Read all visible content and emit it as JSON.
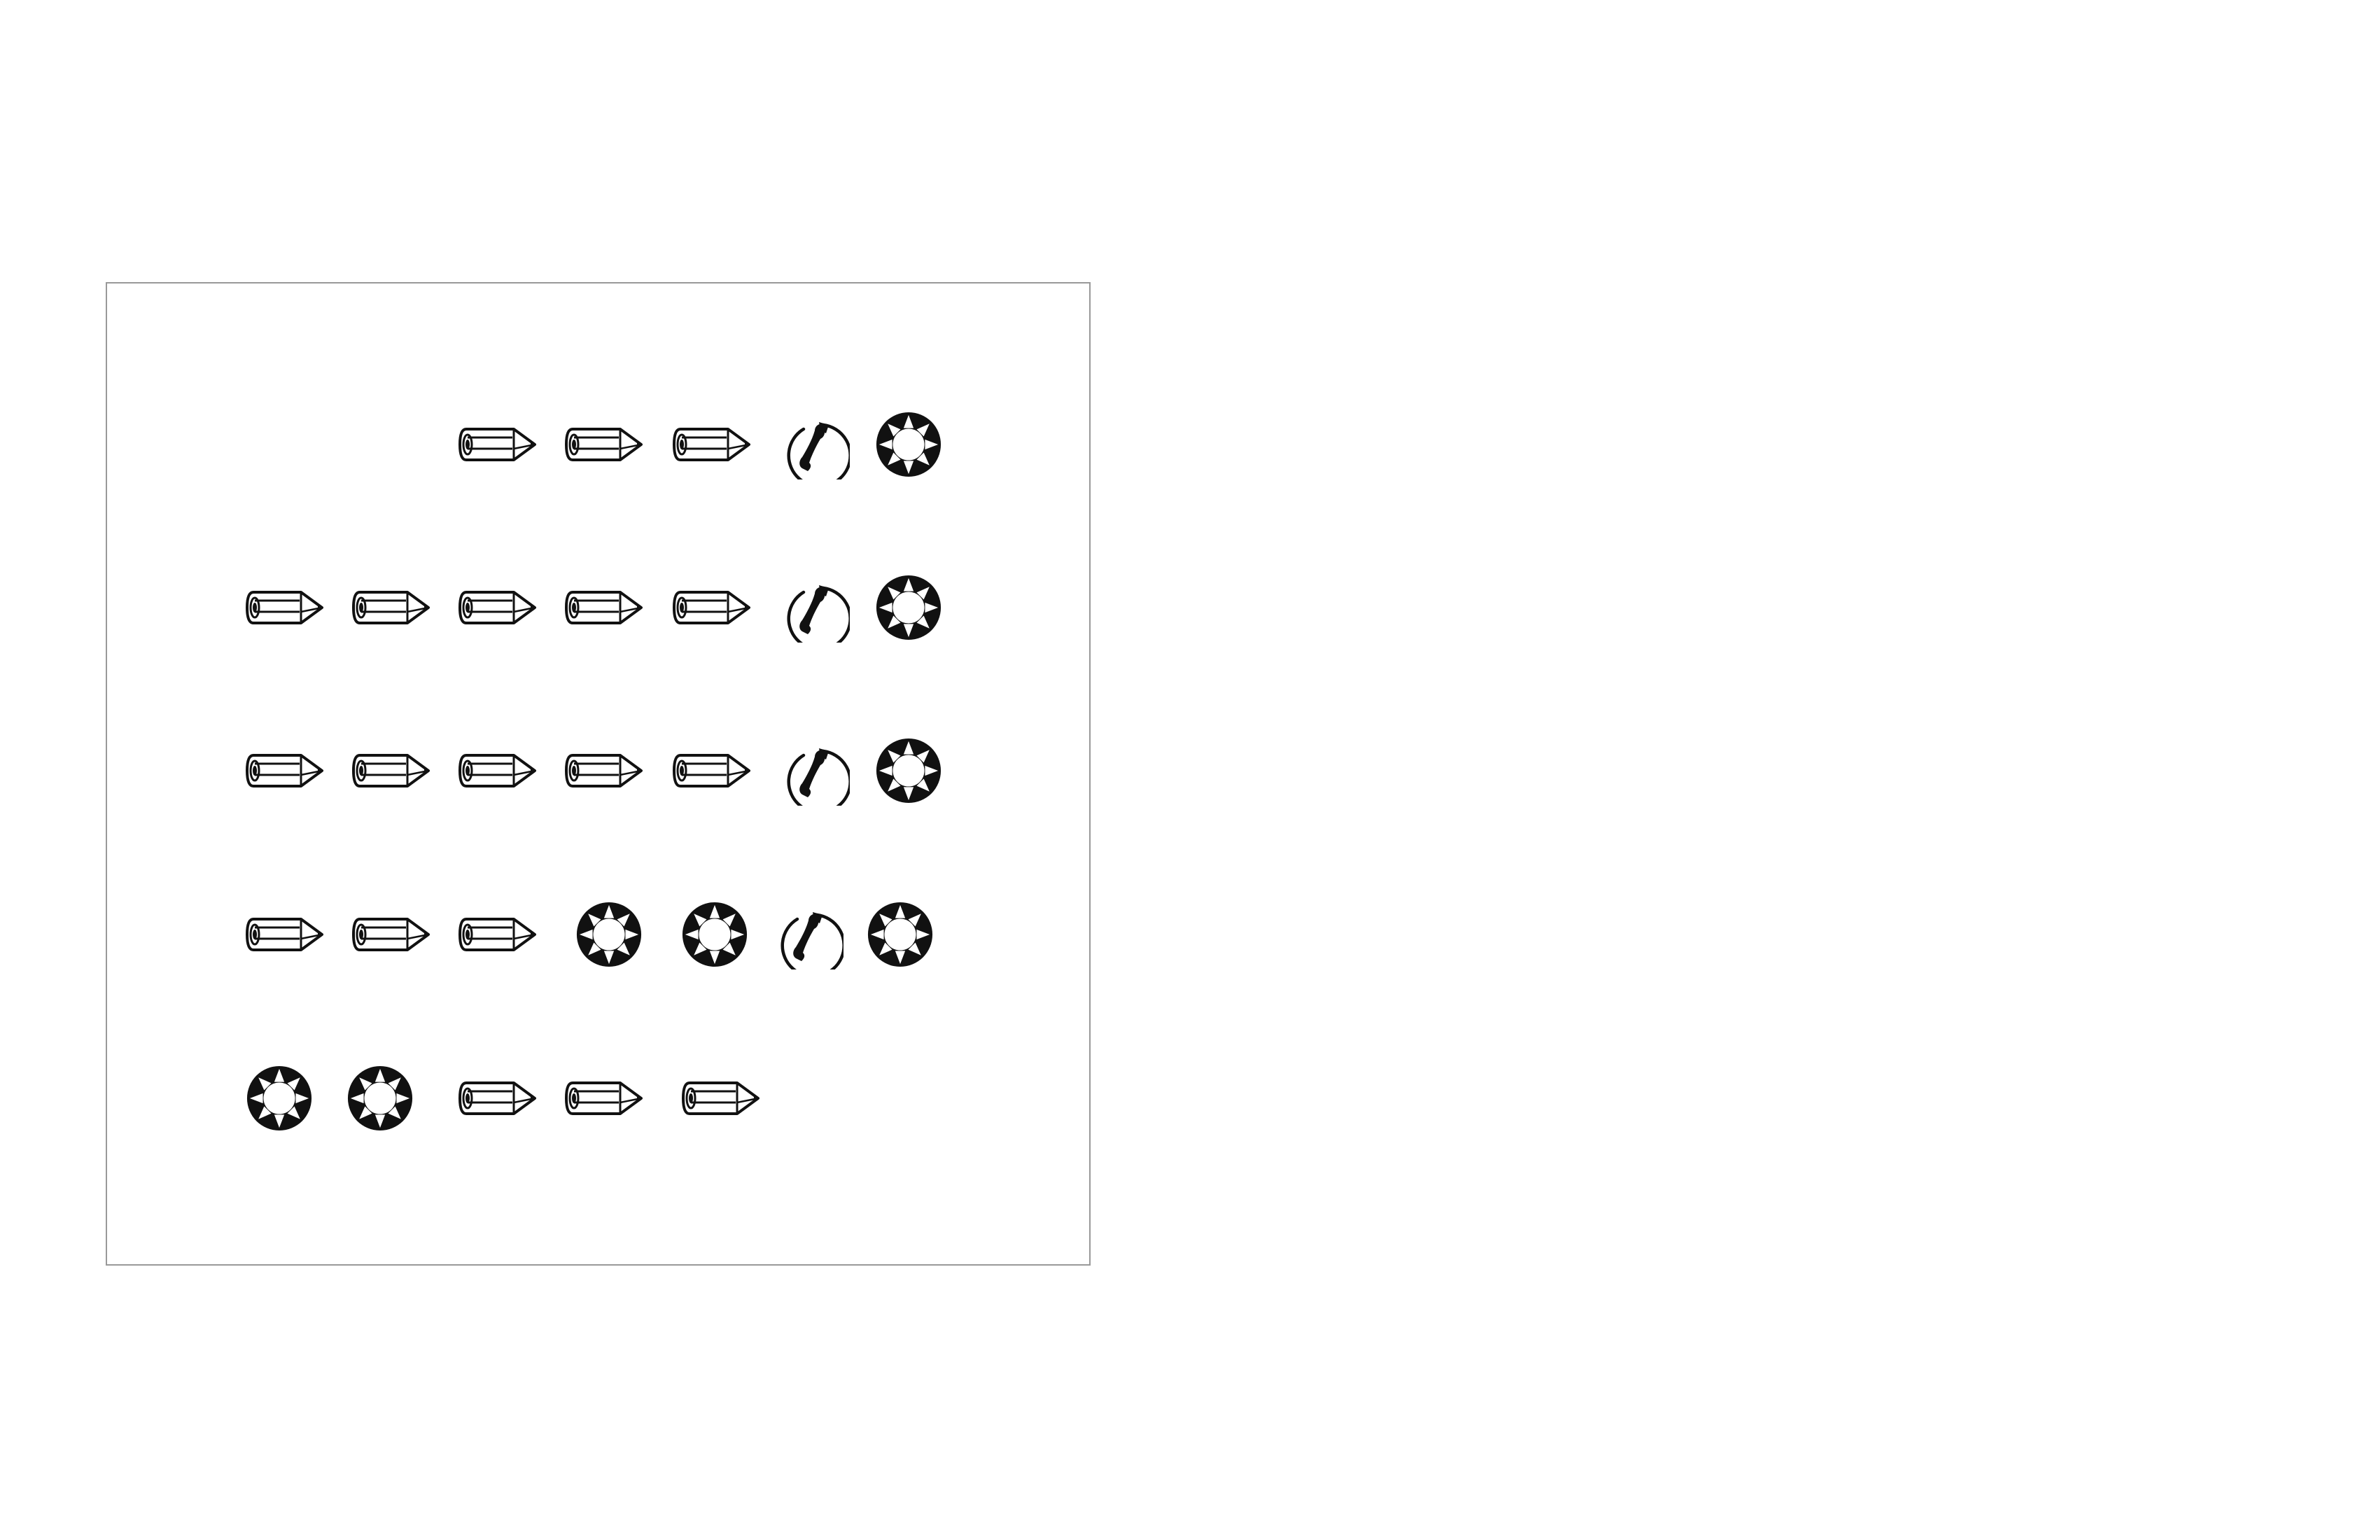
{
  "colors": {
    "ink": "#111111",
    "panel_border": "#999999",
    "background": "#ffffff"
  },
  "rows": [
    {
      "glyphs": [
        "pencil-icon",
        "pencil-icon",
        "pencil-icon",
        "telephone-icon",
        "sun-icon"
      ]
    },
    {
      "glyphs": [
        "pencil-icon",
        "pencil-icon",
        "pencil-icon",
        "pencil-icon",
        "pencil-icon",
        "telephone-icon",
        "sun-icon"
      ]
    },
    {
      "glyphs": [
        "pencil-icon",
        "pencil-icon",
        "pencil-icon",
        "pencil-icon",
        "pencil-icon",
        "telephone-icon",
        "sun-icon"
      ]
    },
    {
      "glyphs": [
        "pencil-icon",
        "pencil-icon",
        "pencil-icon",
        "sun-icon",
        "sun-icon",
        "telephone-icon",
        "sun-icon"
      ]
    },
    {
      "glyphs": [
        "sun-icon",
        "sun-icon",
        "pencil-icon",
        "pencil-icon",
        "pencil-icon"
      ]
    }
  ]
}
